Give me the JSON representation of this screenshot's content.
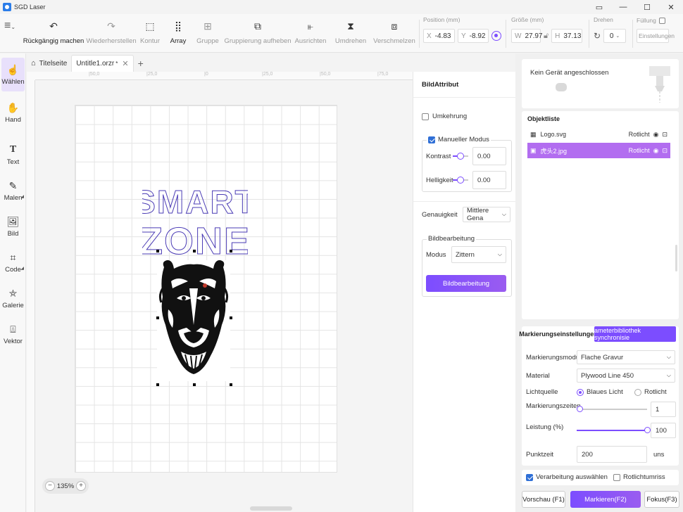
{
  "app": {
    "title": "SGD Laser"
  },
  "toolbar": {
    "undo": "Rückgängig machen",
    "redo": "Wiederherstellen",
    "contour": "Kontur",
    "array": "Array",
    "group": "Gruppe",
    "ungroup": "Gruppierung aufheben",
    "align": "Ausrichten",
    "flip": "Umdrehen",
    "merge": "Verschmelzen",
    "position_title": "Position (mm)",
    "x_label": "X",
    "x_value": "-4.83",
    "y_label": "Y",
    "y_value": "-8.92",
    "size_title": "Größe (mm)",
    "w_label": "W",
    "w_value": "27.97",
    "h_label": "H",
    "h_value": "37.13",
    "rotate_title": "Drehen",
    "rotate_value": "0",
    "fill_title": "Füllung",
    "settings": "Einstellungen"
  },
  "sidebar": {
    "items": [
      {
        "label": "Wählen",
        "icon": "select-pointer-icon"
      },
      {
        "label": "Hand",
        "icon": "hand-icon"
      },
      {
        "label": "Text",
        "icon": "text-icon"
      },
      {
        "label": "Malen",
        "icon": "pen-icon"
      },
      {
        "label": "Bild",
        "icon": "image-icon"
      },
      {
        "label": "Code",
        "icon": "qr-code-icon"
      },
      {
        "label": "Galerie",
        "icon": "gallery-icon"
      },
      {
        "label": "Vektor",
        "icon": "vector-icon"
      }
    ]
  },
  "tabs": {
    "home": "Titelseite",
    "doc": "Untitle1.orzr",
    "modified": "*"
  },
  "ruler": {
    "labels": [
      "|50,0",
      "|25,0",
      "|0",
      "|25,0",
      "|50,0",
      "|75,0"
    ]
  },
  "canvas": {
    "art_line1": "SMART",
    "art_line2": "ZONE",
    "zoom": "135%"
  },
  "props": {
    "title": "BildAttribut",
    "invert": "Umkehrung",
    "manual_mode": "Manueller Modus",
    "contrast_label": "Kontrast",
    "contrast_value": "0.00",
    "brightness_label": "Helligkeit",
    "brightness_value": "0.00",
    "accuracy_label": "Genauigkeit",
    "accuracy_value": "Mittlere Gena",
    "image_edit_title": "Bildbearbeitung",
    "mode_label": "Modus",
    "mode_value": "Zittern",
    "image_edit_button": "Bildbearbeitung"
  },
  "device": {
    "status": "Kein Gerät angeschlossen"
  },
  "objects": {
    "title": "Objektliste",
    "items": [
      {
        "name": "Logo.svg",
        "light": "Rotlicht"
      },
      {
        "name": "虎头2.jpg",
        "light": "Rotlicht"
      }
    ]
  },
  "marking": {
    "tab1": "Markierungseinstellungen",
    "tab2": "ameterbibliothek synchronisie",
    "mode_label": "Markierungsmodus",
    "mode_value": "Flache Gravur",
    "material_label": "Material",
    "material_value": "Plywood Line 450",
    "light_label": "Lichtquelle",
    "light_blue": "Blaues Licht",
    "light_red": "Rotlicht",
    "times_label": "Markierungszeiten",
    "times_value": "1",
    "times_fraction": 0.0,
    "power_label": "Leistung (%)",
    "power_value": "100",
    "power_fraction": 1.0,
    "dot_label": "Punktzeit",
    "dot_value": "200",
    "dot_unit": "uns"
  },
  "footer": {
    "process_selected": "Verarbeitung auswählen",
    "red_outline": "Rotlichtumriss",
    "preview": "Vorschau (F1)",
    "mark": "Markieren(F2)",
    "focus": "Fokus(F3)"
  },
  "colors": {
    "accent": "#7c4dff",
    "selection": "#b26df0",
    "logo_stroke": "#4a3bb5"
  }
}
